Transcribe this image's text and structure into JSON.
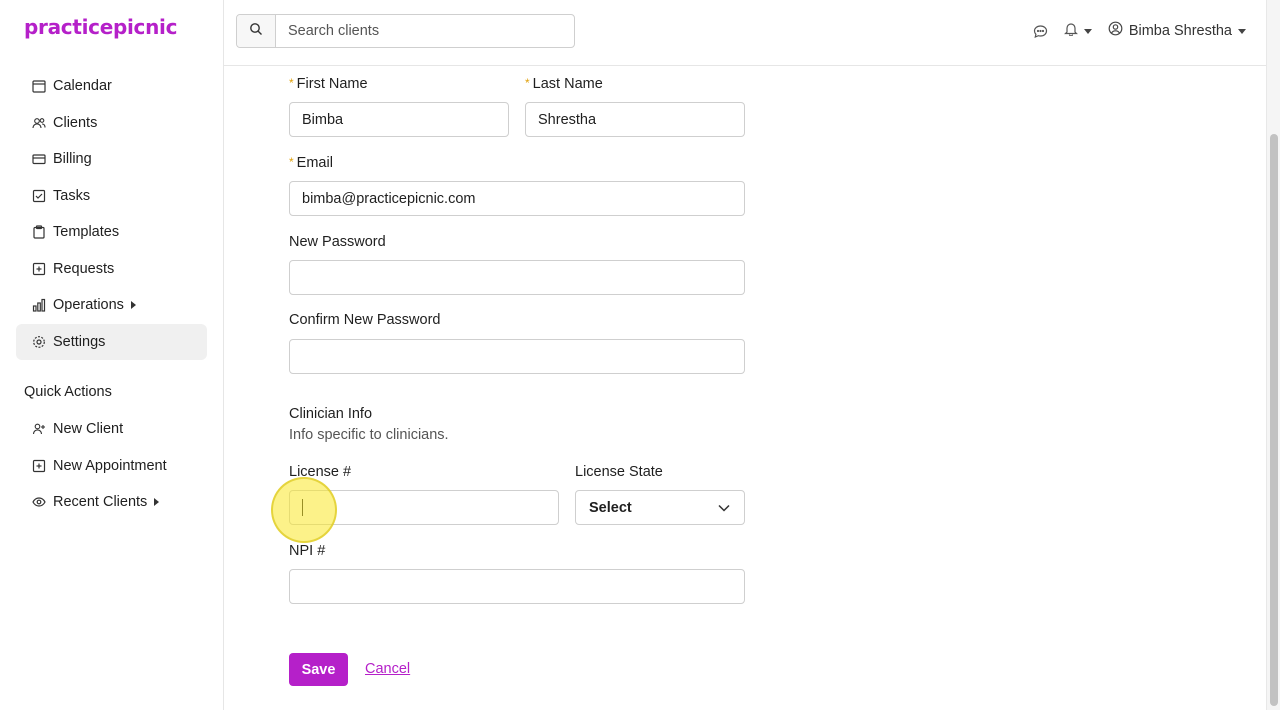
{
  "brand": {
    "name": "practicepicnic",
    "color": "#b520c9"
  },
  "sidebar": {
    "items": [
      {
        "label": "Calendar",
        "icon": "calendar-icon"
      },
      {
        "label": "Clients",
        "icon": "users-icon"
      },
      {
        "label": "Billing",
        "icon": "credit-card-icon"
      },
      {
        "label": "Tasks",
        "icon": "checkbox-icon"
      },
      {
        "label": "Templates",
        "icon": "clipboard-icon"
      },
      {
        "label": "Requests",
        "icon": "plus-square-icon"
      },
      {
        "label": "Operations",
        "icon": "bar-chart-icon",
        "has_submenu": true
      },
      {
        "label": "Settings",
        "icon": "gear-icon",
        "active": true
      }
    ],
    "quick_actions_title": "Quick Actions",
    "quick_actions": [
      {
        "label": "New Client",
        "icon": "user-plus-icon"
      },
      {
        "label": "New Appointment",
        "icon": "plus-square-icon"
      },
      {
        "label": "Recent Clients",
        "icon": "eye-icon",
        "has_submenu": true
      }
    ]
  },
  "header": {
    "search_placeholder": "Search clients",
    "user_name": "Bimba Shrestha",
    "icons": [
      "chat-icon",
      "bell-icon",
      "user-circle-icon"
    ]
  },
  "form": {
    "first_name_label": "First Name",
    "first_name_value": "Bimba",
    "last_name_label": "Last Name",
    "last_name_value": "Shrestha",
    "email_label": "Email",
    "email_value": "bimba@practicepicnic.com",
    "new_password_label": "New Password",
    "confirm_password_label": "Confirm New Password",
    "clinician_title": "Clinician Info",
    "clinician_subtitle": "Info specific to clinicians.",
    "license_label": "License #",
    "license_value": "",
    "license_state_label": "License State",
    "license_state_value": "Select",
    "npi_label": "NPI #",
    "npi_value": "",
    "save_label": "Save",
    "cancel_label": "Cancel",
    "required_mark": "*",
    "required_color": "#e0a10d"
  }
}
